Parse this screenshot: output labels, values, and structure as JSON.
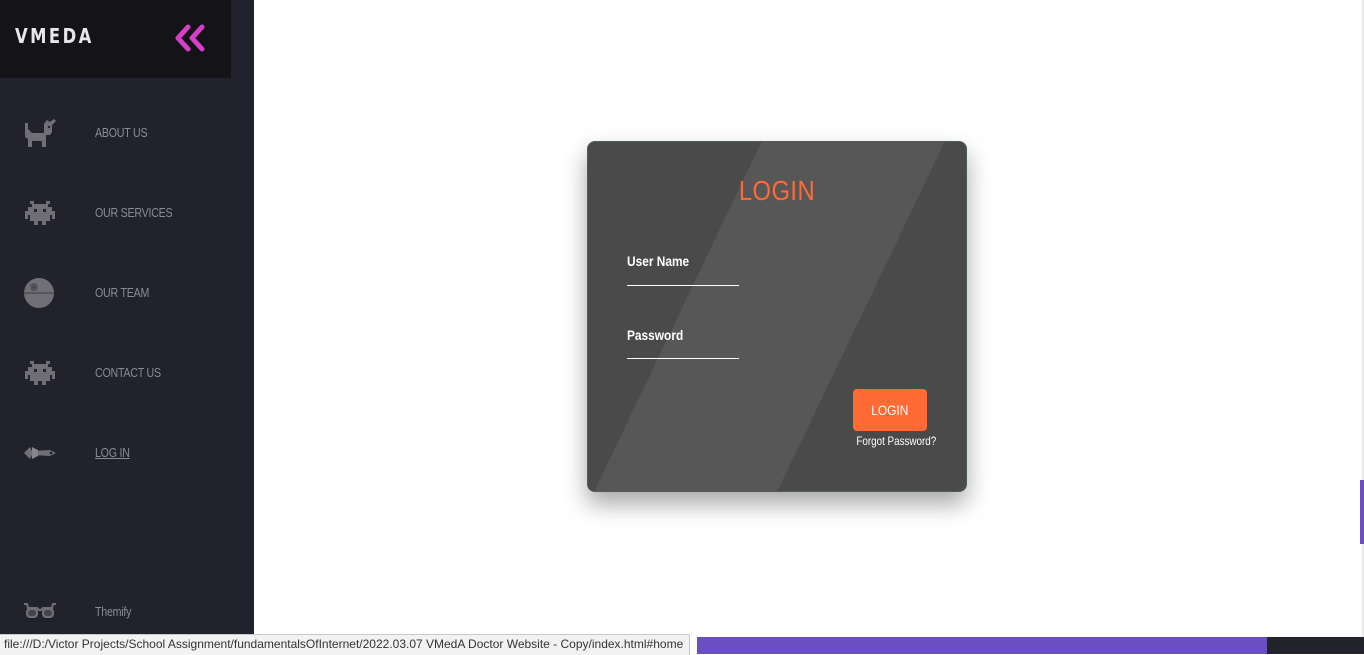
{
  "sidebar": {
    "brand": "VMEDA",
    "accent_color": "#d63fc6",
    "items": [
      {
        "label": "ABOUT US",
        "icon": "cat-icon"
      },
      {
        "label": "OUR SERVICES",
        "icon": "space-invader-icon"
      },
      {
        "label": "OUR TEAM",
        "icon": "death-star-icon"
      },
      {
        "label": "CONTACT US",
        "icon": "space-invader-icon"
      },
      {
        "label": "LOG IN",
        "icon": "spaceship-icon"
      }
    ],
    "footer_item": {
      "label": "Themify",
      "icon": "glasses-icon"
    }
  },
  "login_card": {
    "title": "LOGIN",
    "username_label": "User Name",
    "password_label": "Password",
    "button_label": "LOGIN",
    "forgot_label": "Forgot Password?",
    "accent_color": "#ff6a35"
  },
  "status_bar": {
    "url": "file:///D:/Victor Projects/School Assignment/fundamentalsOfInternet/2022.03.07 VMedA Doctor Website - Copy/index.html#home"
  }
}
